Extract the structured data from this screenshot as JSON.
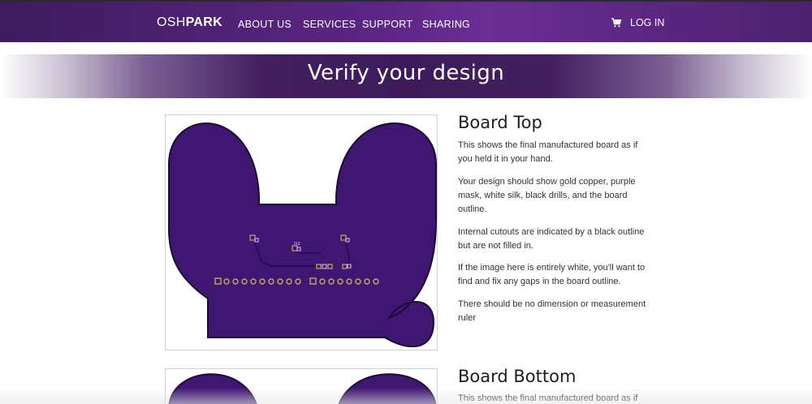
{
  "header": {
    "logo_thin": "OSH",
    "logo_bold": "PARK",
    "nav": [
      "ABOUT US",
      "SERVICES",
      "SUPPORT",
      "SHARING"
    ],
    "login": "LOG IN"
  },
  "banner": {
    "title": "Verify your design"
  },
  "board_top": {
    "title": "Board Top",
    "paragraphs": [
      "This shows the final manufactured board as if you held it in your hand.",
      "Your design should show gold copper, purple mask, white silk, black drills, and the board outline.",
      "Internal cutouts are indicated by a black outline but are not filled in.",
      "If the image here is entirely white, you'll want to find and fix any gaps in the board outline.",
      "There should be no dimension or measurement ruler"
    ],
    "silk_label": "D2"
  },
  "board_bottom": {
    "title": "Board Bottom",
    "paragraphs": [
      "This shows the final manufactured board as if"
    ]
  },
  "colors": {
    "mask": "#3f1672",
    "outline": "#1c0a33",
    "copper": "#c9a760",
    "nav_bg": "#5b2583"
  },
  "icons": {
    "cart": "cart-icon"
  }
}
